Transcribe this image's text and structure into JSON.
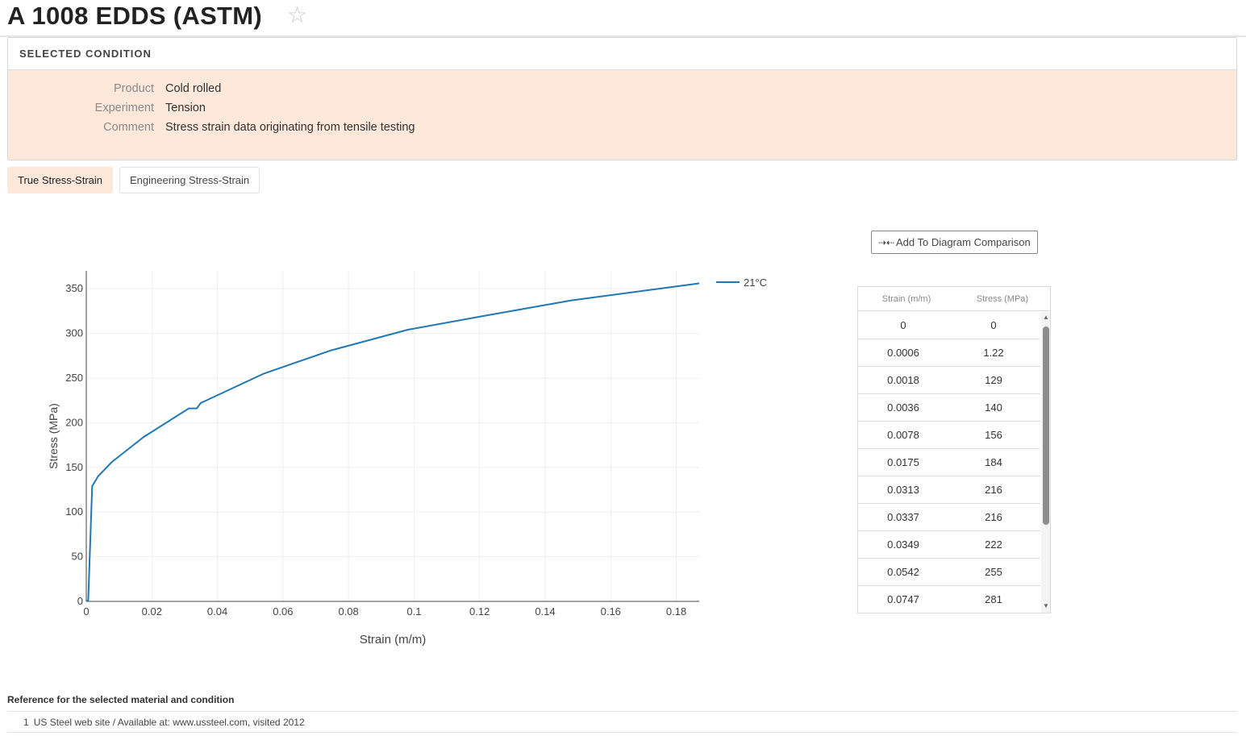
{
  "page": {
    "title": "A 1008 EDDS (ASTM)",
    "star_icon": "star-outline-icon"
  },
  "condition": {
    "header": "SELECTED CONDITION",
    "rows": [
      {
        "label": "Product",
        "value": "Cold rolled"
      },
      {
        "label": "Experiment",
        "value": "Tension"
      },
      {
        "label": "Comment",
        "value": "Stress strain data originating from tensile testing"
      }
    ]
  },
  "tabs": [
    {
      "label": "True Stress-Strain",
      "active": true
    },
    {
      "label": "Engineering Stress-Strain",
      "active": false
    }
  ],
  "compare_button": {
    "label": "Add To Diagram Comparison",
    "icon": "compare-arrows-icon"
  },
  "table": {
    "headers": [
      "Strain (m/m)",
      "Stress (MPa)"
    ],
    "rows": [
      [
        "0",
        "0"
      ],
      [
        "0.0006",
        "1.22"
      ],
      [
        "0.0018",
        "129"
      ],
      [
        "0.0036",
        "140"
      ],
      [
        "0.0078",
        "156"
      ],
      [
        "0.0175",
        "184"
      ],
      [
        "0.0313",
        "216"
      ],
      [
        "0.0337",
        "216"
      ],
      [
        "0.0349",
        "222"
      ],
      [
        "0.0542",
        "255"
      ],
      [
        "0.0747",
        "281"
      ]
    ]
  },
  "chart_data": {
    "type": "line",
    "title": "",
    "xlabel": "Strain (m/m)",
    "ylabel": "Stress (MPa)",
    "xlim": [
      0,
      0.187
    ],
    "ylim": [
      0,
      370
    ],
    "x_ticks": [
      "0",
      "0.02",
      "0.04",
      "0.06",
      "0.08",
      "0.1",
      "0.12",
      "0.14",
      "0.16",
      "0.18"
    ],
    "x_tick_values": [
      0,
      0.02,
      0.04,
      0.06,
      0.08,
      0.1,
      0.12,
      0.14,
      0.16,
      0.18
    ],
    "y_ticks": [
      "0",
      "50",
      "100",
      "150",
      "200",
      "250",
      "300",
      "350"
    ],
    "y_tick_values": [
      0,
      50,
      100,
      150,
      200,
      250,
      300,
      350
    ],
    "grid": true,
    "legend": "top-right",
    "color": "#1f77b4",
    "series": [
      {
        "name": "21°C",
        "x": [
          0,
          0.0006,
          0.0018,
          0.0036,
          0.0078,
          0.0175,
          0.0313,
          0.0337,
          0.0349,
          0.0542,
          0.0747,
          0.098,
          0.122,
          0.148,
          0.187
        ],
        "y": [
          0,
          1.22,
          129,
          140,
          156,
          184,
          216,
          216,
          222,
          255,
          281,
          304,
          320,
          337,
          356
        ]
      }
    ]
  },
  "reference": {
    "title": "Reference for the selected material and condition",
    "items": [
      {
        "num": "1",
        "text": "US Steel web site / Available at: www.ussteel.com, visited 2012"
      }
    ]
  }
}
